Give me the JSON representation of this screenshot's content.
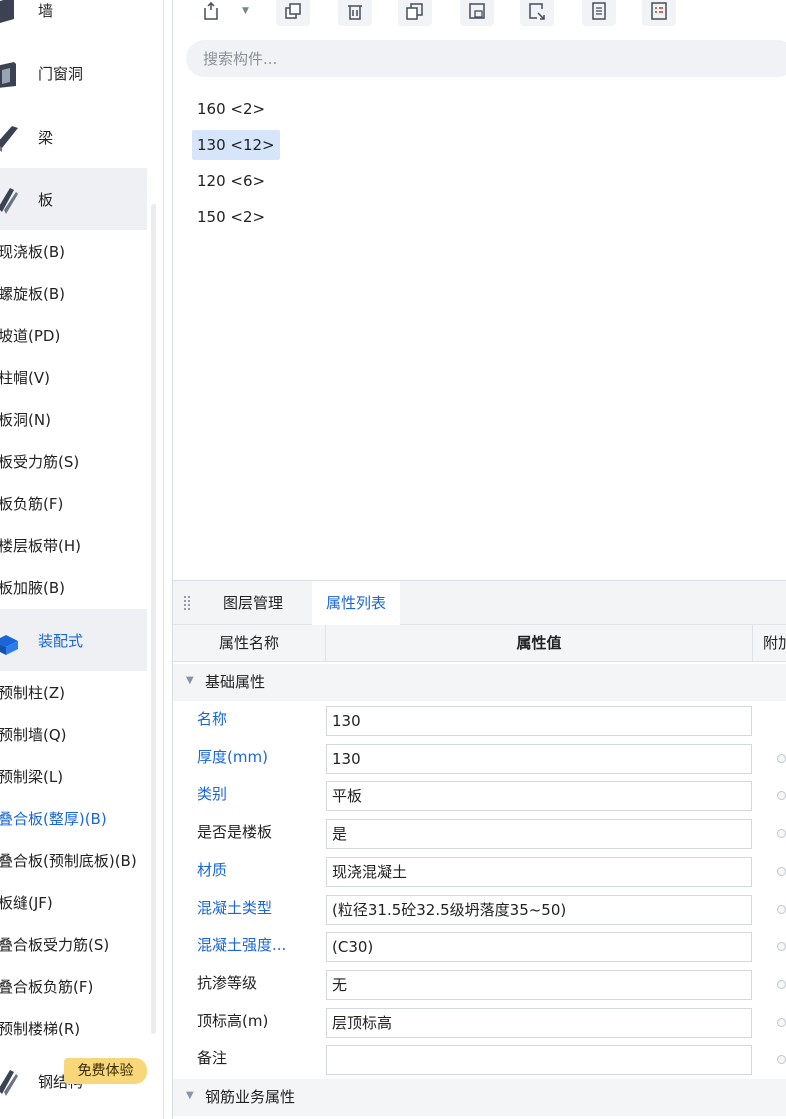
{
  "sidebar": {
    "categories": [
      {
        "label": "墙",
        "icon": "wall-icon"
      },
      {
        "label": "门窗洞",
        "icon": "door-window-icon"
      },
      {
        "label": "梁",
        "icon": "beam-icon"
      },
      {
        "label": "板",
        "icon": "slab-icon"
      },
      {
        "label": "装配式",
        "icon": "prefab-icon"
      },
      {
        "label": "钢结构",
        "icon": "steel-structure-icon"
      }
    ],
    "slab_items": [
      "现浇板(B)",
      "螺旋板(B)",
      "坡道(PD)",
      "柱帽(V)",
      "板洞(N)",
      "板受力筋(S)",
      "板负筋(F)",
      "楼层板带(H)",
      "板加腋(B)"
    ],
    "prefab_items": [
      "预制柱(Z)",
      "预制墙(Q)",
      "预制梁(L)",
      "叠合板(整厚)(B)",
      "叠合板(预制底板)(B)",
      "板缝(JF)",
      "叠合板受力筋(S)",
      "叠合板负筋(F)",
      "预制楼梯(R)"
    ],
    "selected_prefab_index": 3,
    "trial_badge": "免费体验"
  },
  "toolbar": {
    "buttons": [
      "new-icon",
      "copy-icon",
      "delete-icon",
      "duplicate-icon",
      "save-icon",
      "export-icon",
      "document-icon",
      "list-icon"
    ]
  },
  "search": {
    "placeholder": "搜索构件...",
    "value": ""
  },
  "components": [
    {
      "label": "160 <2>",
      "selected": false
    },
    {
      "label": "130 <12>",
      "selected": true
    },
    {
      "label": "120 <6>",
      "selected": false
    },
    {
      "label": "150 <2>",
      "selected": false
    }
  ],
  "panel": {
    "tabs": [
      {
        "label": "图层管理",
        "active": false
      },
      {
        "label": "属性列表",
        "active": true
      }
    ],
    "columns": {
      "name": "属性名称",
      "value": "属性值",
      "extra": "附加"
    },
    "group_basic": "基础属性",
    "properties": [
      {
        "name": "名称",
        "value": "130",
        "link": true,
        "check": false
      },
      {
        "name": "厚度(mm)",
        "value": "130",
        "link": true,
        "check": true
      },
      {
        "name": "类别",
        "value": "平板",
        "link": true,
        "check": true
      },
      {
        "name": "是否是楼板",
        "value": "是",
        "link": false,
        "check": true
      },
      {
        "name": "材质",
        "value": "现浇混凝土",
        "link": true,
        "check": true
      },
      {
        "name": "混凝土类型",
        "value": "(粒径31.5砼32.5级坍落度35~50)",
        "link": true,
        "check": true
      },
      {
        "name": "混凝土强度...",
        "value": "(C30)",
        "link": true,
        "check": true
      },
      {
        "name": "抗渗等级",
        "value": "无",
        "link": false,
        "check": true
      },
      {
        "name": "顶标高(m)",
        "value": "层顶标高",
        "link": false,
        "check": true
      },
      {
        "name": "备注",
        "value": "",
        "link": false,
        "check": true
      }
    ],
    "group_rebar": "钢筋业务属性"
  },
  "colors": {
    "accent": "#1a66d8",
    "selected_bg": "#d6e5f9",
    "trial_badge": "#f7d77a"
  }
}
